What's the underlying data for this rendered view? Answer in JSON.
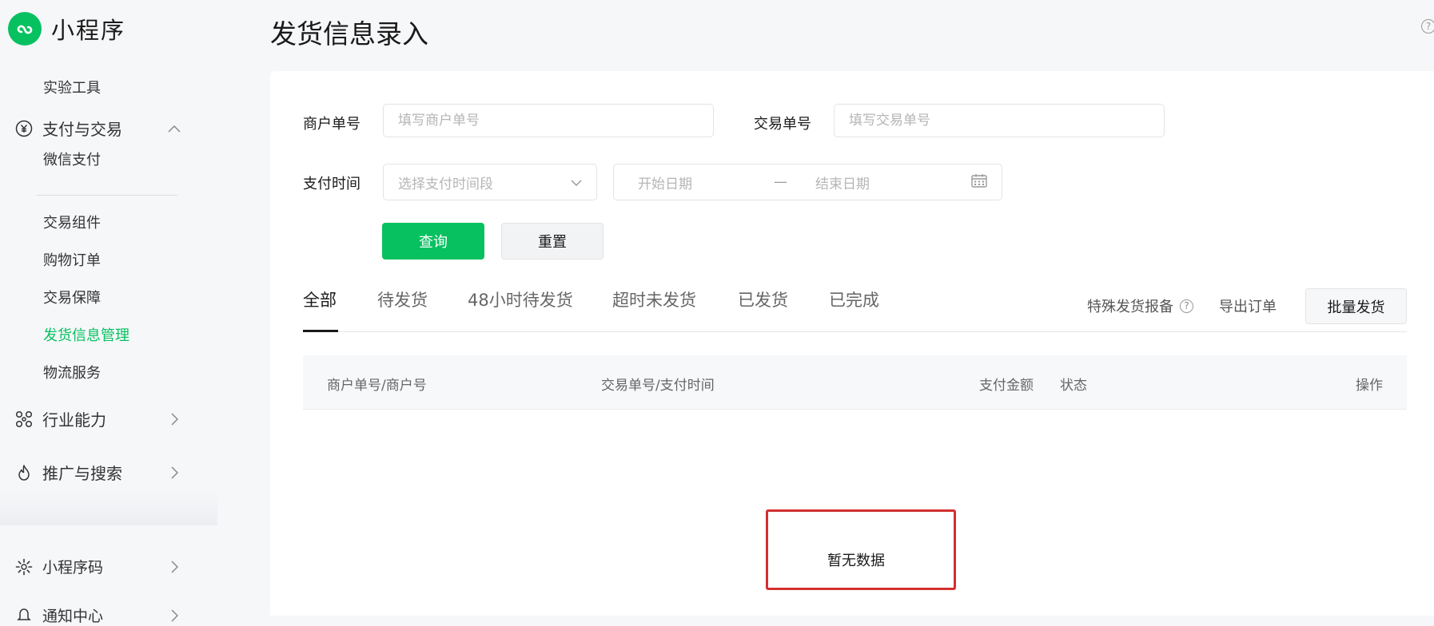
{
  "app": {
    "name": "小程序"
  },
  "sidebar": {
    "top_item": "实验工具",
    "group_pay": {
      "label": "支付与交易",
      "items": [
        "微信支付",
        "交易组件",
        "购物订单",
        "交易保障",
        "发货信息管理",
        "物流服务"
      ],
      "active": "发货信息管理"
    },
    "group_industry": {
      "label": "行业能力"
    },
    "group_promo": {
      "label": "推广与搜索"
    },
    "group_qr": {
      "label": "小程序码"
    },
    "group_notice": {
      "label": "通知中心"
    }
  },
  "page": {
    "title": "发货信息录入"
  },
  "filters": {
    "merchant_no": {
      "label": "商户单号",
      "placeholder": "填写商户单号"
    },
    "trade_no": {
      "label": "交易单号",
      "placeholder": "填写交易单号"
    },
    "pay_time": {
      "label": "支付时间",
      "placeholder": "选择支付时间段",
      "start_placeholder": "开始日期",
      "separator": "—",
      "end_placeholder": "结束日期"
    },
    "query_label": "查询",
    "reset_label": "重置"
  },
  "tabs": [
    {
      "label": "全部",
      "active": true
    },
    {
      "label": "待发货"
    },
    {
      "label": "48小时待发货"
    },
    {
      "label": "超时未发货"
    },
    {
      "label": "已发货"
    },
    {
      "label": "已完成"
    }
  ],
  "toolbar": {
    "special_report": "特殊发货报备",
    "export_orders": "导出订单",
    "batch_ship": "批量发货"
  },
  "table": {
    "columns": [
      "商户单号/商户号",
      "交易单号/支付时间",
      "支付金额",
      "状态",
      "操作"
    ],
    "empty_text": "暂无数据"
  },
  "colors": {
    "accent": "#07c160",
    "highlight_border": "#d32f2f"
  }
}
